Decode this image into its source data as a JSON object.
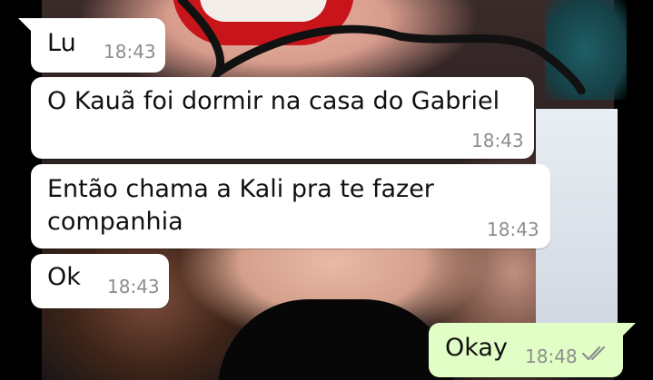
{
  "messages": [
    {
      "direction": "in",
      "text": "Lu",
      "time": "18:43"
    },
    {
      "direction": "in",
      "text": "O Kauã foi dormir na casa do Gabriel",
      "time": "18:43"
    },
    {
      "direction": "in",
      "text": "Então chama a Kali pra te fazer\ncompanhia",
      "time": "18:43"
    },
    {
      "direction": "in",
      "text": "Ok",
      "time": "18:43"
    },
    {
      "direction": "out",
      "text": "Okay",
      "time": "18:48",
      "status_icon": "double-check-icon"
    }
  ],
  "colors": {
    "incoming_bubble": "#ffffff",
    "outgoing_bubble": "#e1fec6",
    "timestamp": "#8a8f8c",
    "read_ticks": "#8a8f8c"
  }
}
